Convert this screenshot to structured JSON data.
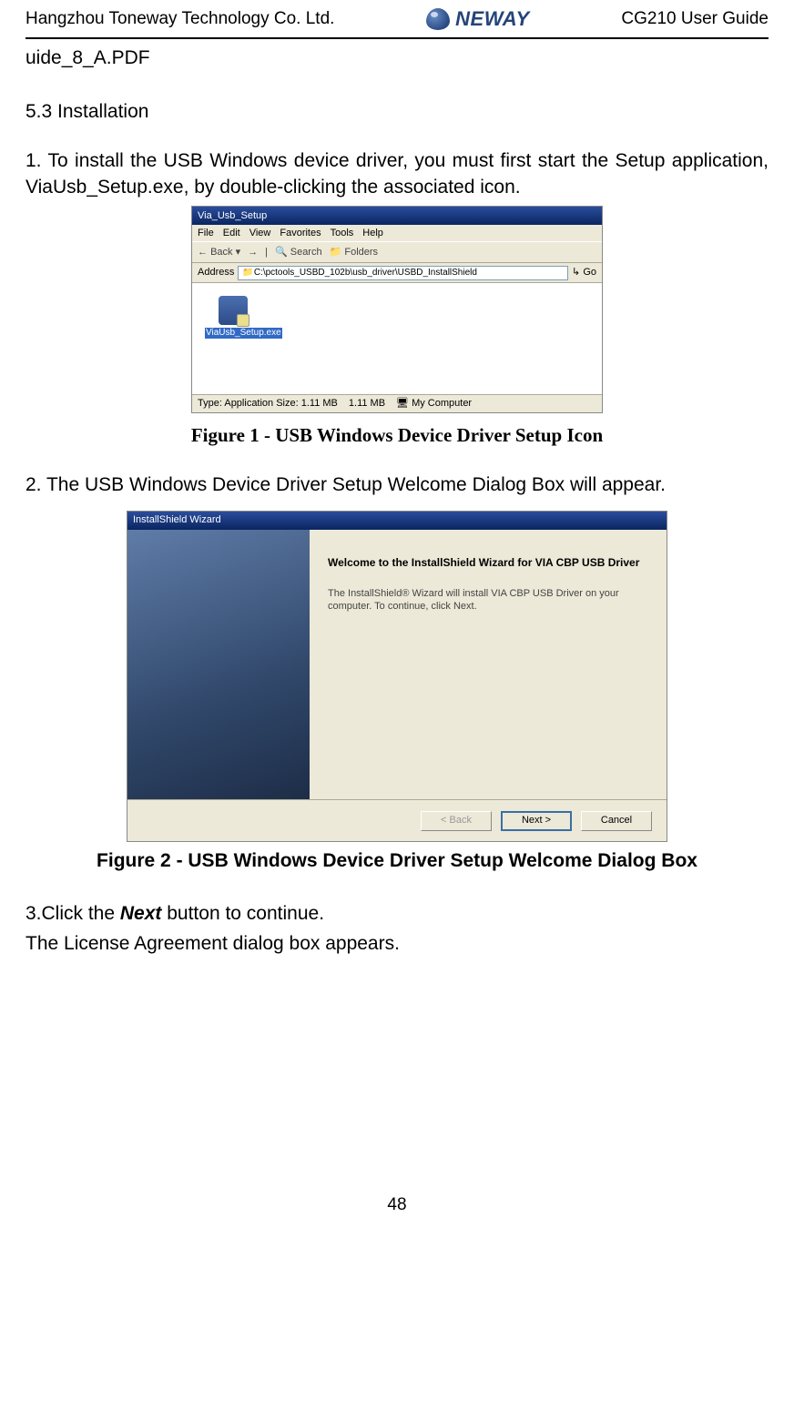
{
  "header": {
    "company": "Hangzhou Toneway Technology Co. Ltd.",
    "logo_text": "NEWAY",
    "doc_title": "CG210 User Guide"
  },
  "fragment_top": "uide_8_A.PDF",
  "section_heading": "5.3 Installation",
  "step1": "1. To install the USB Windows device driver, you must first start the Setup application, ViaUsb_Setup.exe, by double-clicking the associated icon.",
  "figure1": {
    "titlebar": "Via_Usb_Setup",
    "menu": [
      "File",
      "Edit",
      "View",
      "Favorites",
      "Tools",
      "Help"
    ],
    "toolbar": [
      "Back",
      "Search",
      "Folders"
    ],
    "address_label": "Address",
    "address_path": "C:\\pctools_USBD_102b\\usb_driver\\USBD_InstallShield",
    "go_label": "Go",
    "icon_label": "ViaUsb_Setup.exe",
    "status": {
      "type": "Type: Application Size: 1.11 MB",
      "size": "1.11 MB",
      "location": "My Computer"
    }
  },
  "caption1": "Figure 1 - USB Windows Device Driver Setup Icon",
  "step2": "2. The USB Windows Device Driver Setup Welcome Dialog Box will appear.",
  "figure2": {
    "titlebar": "InstallShield Wizard",
    "heading": "Welcome to the InstallShield Wizard for VIA CBP USB Driver",
    "body": "The InstallShield® Wizard will install VIA CBP USB Driver on your computer.  To continue, click Next.",
    "buttons": {
      "back": "< Back",
      "next": "Next >",
      "cancel": "Cancel"
    }
  },
  "caption2": "Figure 2 - USB Windows Device Driver Setup Welcome Dialog Box",
  "step3_prefix": "3.Click the ",
  "step3_em": "Next",
  "step3_suffix": " button to continue.",
  "step3_line2": "The License Agreement dialog box appears.",
  "page_number": "48"
}
